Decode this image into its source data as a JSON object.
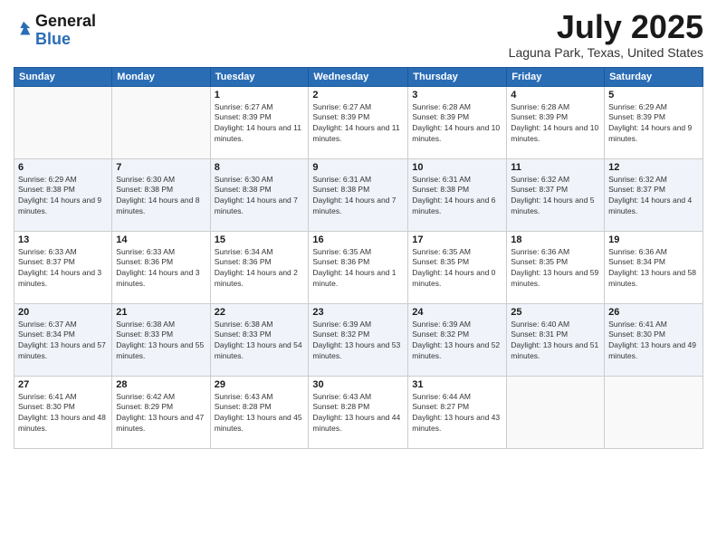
{
  "logo": {
    "general": "General",
    "blue": "Blue"
  },
  "header": {
    "month": "July 2025",
    "location": "Laguna Park, Texas, United States"
  },
  "weekdays": [
    "Sunday",
    "Monday",
    "Tuesday",
    "Wednesday",
    "Thursday",
    "Friday",
    "Saturday"
  ],
  "weeks": [
    [
      {
        "day": "",
        "sunrise": "",
        "sunset": "",
        "daylight": ""
      },
      {
        "day": "",
        "sunrise": "",
        "sunset": "",
        "daylight": ""
      },
      {
        "day": "1",
        "sunrise": "Sunrise: 6:27 AM",
        "sunset": "Sunset: 8:39 PM",
        "daylight": "Daylight: 14 hours and 11 minutes."
      },
      {
        "day": "2",
        "sunrise": "Sunrise: 6:27 AM",
        "sunset": "Sunset: 8:39 PM",
        "daylight": "Daylight: 14 hours and 11 minutes."
      },
      {
        "day": "3",
        "sunrise": "Sunrise: 6:28 AM",
        "sunset": "Sunset: 8:39 PM",
        "daylight": "Daylight: 14 hours and 10 minutes."
      },
      {
        "day": "4",
        "sunrise": "Sunrise: 6:28 AM",
        "sunset": "Sunset: 8:39 PM",
        "daylight": "Daylight: 14 hours and 10 minutes."
      },
      {
        "day": "5",
        "sunrise": "Sunrise: 6:29 AM",
        "sunset": "Sunset: 8:39 PM",
        "daylight": "Daylight: 14 hours and 9 minutes."
      }
    ],
    [
      {
        "day": "6",
        "sunrise": "Sunrise: 6:29 AM",
        "sunset": "Sunset: 8:38 PM",
        "daylight": "Daylight: 14 hours and 9 minutes."
      },
      {
        "day": "7",
        "sunrise": "Sunrise: 6:30 AM",
        "sunset": "Sunset: 8:38 PM",
        "daylight": "Daylight: 14 hours and 8 minutes."
      },
      {
        "day": "8",
        "sunrise": "Sunrise: 6:30 AM",
        "sunset": "Sunset: 8:38 PM",
        "daylight": "Daylight: 14 hours and 7 minutes."
      },
      {
        "day": "9",
        "sunrise": "Sunrise: 6:31 AM",
        "sunset": "Sunset: 8:38 PM",
        "daylight": "Daylight: 14 hours and 7 minutes."
      },
      {
        "day": "10",
        "sunrise": "Sunrise: 6:31 AM",
        "sunset": "Sunset: 8:38 PM",
        "daylight": "Daylight: 14 hours and 6 minutes."
      },
      {
        "day": "11",
        "sunrise": "Sunrise: 6:32 AM",
        "sunset": "Sunset: 8:37 PM",
        "daylight": "Daylight: 14 hours and 5 minutes."
      },
      {
        "day": "12",
        "sunrise": "Sunrise: 6:32 AM",
        "sunset": "Sunset: 8:37 PM",
        "daylight": "Daylight: 14 hours and 4 minutes."
      }
    ],
    [
      {
        "day": "13",
        "sunrise": "Sunrise: 6:33 AM",
        "sunset": "Sunset: 8:37 PM",
        "daylight": "Daylight: 14 hours and 3 minutes."
      },
      {
        "day": "14",
        "sunrise": "Sunrise: 6:33 AM",
        "sunset": "Sunset: 8:36 PM",
        "daylight": "Daylight: 14 hours and 3 minutes."
      },
      {
        "day": "15",
        "sunrise": "Sunrise: 6:34 AM",
        "sunset": "Sunset: 8:36 PM",
        "daylight": "Daylight: 14 hours and 2 minutes."
      },
      {
        "day": "16",
        "sunrise": "Sunrise: 6:35 AM",
        "sunset": "Sunset: 8:36 PM",
        "daylight": "Daylight: 14 hours and 1 minute."
      },
      {
        "day": "17",
        "sunrise": "Sunrise: 6:35 AM",
        "sunset": "Sunset: 8:35 PM",
        "daylight": "Daylight: 14 hours and 0 minutes."
      },
      {
        "day": "18",
        "sunrise": "Sunrise: 6:36 AM",
        "sunset": "Sunset: 8:35 PM",
        "daylight": "Daylight: 13 hours and 59 minutes."
      },
      {
        "day": "19",
        "sunrise": "Sunrise: 6:36 AM",
        "sunset": "Sunset: 8:34 PM",
        "daylight": "Daylight: 13 hours and 58 minutes."
      }
    ],
    [
      {
        "day": "20",
        "sunrise": "Sunrise: 6:37 AM",
        "sunset": "Sunset: 8:34 PM",
        "daylight": "Daylight: 13 hours and 57 minutes."
      },
      {
        "day": "21",
        "sunrise": "Sunrise: 6:38 AM",
        "sunset": "Sunset: 8:33 PM",
        "daylight": "Daylight: 13 hours and 55 minutes."
      },
      {
        "day": "22",
        "sunrise": "Sunrise: 6:38 AM",
        "sunset": "Sunset: 8:33 PM",
        "daylight": "Daylight: 13 hours and 54 minutes."
      },
      {
        "day": "23",
        "sunrise": "Sunrise: 6:39 AM",
        "sunset": "Sunset: 8:32 PM",
        "daylight": "Daylight: 13 hours and 53 minutes."
      },
      {
        "day": "24",
        "sunrise": "Sunrise: 6:39 AM",
        "sunset": "Sunset: 8:32 PM",
        "daylight": "Daylight: 13 hours and 52 minutes."
      },
      {
        "day": "25",
        "sunrise": "Sunrise: 6:40 AM",
        "sunset": "Sunset: 8:31 PM",
        "daylight": "Daylight: 13 hours and 51 minutes."
      },
      {
        "day": "26",
        "sunrise": "Sunrise: 6:41 AM",
        "sunset": "Sunset: 8:30 PM",
        "daylight": "Daylight: 13 hours and 49 minutes."
      }
    ],
    [
      {
        "day": "27",
        "sunrise": "Sunrise: 6:41 AM",
        "sunset": "Sunset: 8:30 PM",
        "daylight": "Daylight: 13 hours and 48 minutes."
      },
      {
        "day": "28",
        "sunrise": "Sunrise: 6:42 AM",
        "sunset": "Sunset: 8:29 PM",
        "daylight": "Daylight: 13 hours and 47 minutes."
      },
      {
        "day": "29",
        "sunrise": "Sunrise: 6:43 AM",
        "sunset": "Sunset: 8:28 PM",
        "daylight": "Daylight: 13 hours and 45 minutes."
      },
      {
        "day": "30",
        "sunrise": "Sunrise: 6:43 AM",
        "sunset": "Sunset: 8:28 PM",
        "daylight": "Daylight: 13 hours and 44 minutes."
      },
      {
        "day": "31",
        "sunrise": "Sunrise: 6:44 AM",
        "sunset": "Sunset: 8:27 PM",
        "daylight": "Daylight: 13 hours and 43 minutes."
      },
      {
        "day": "",
        "sunrise": "",
        "sunset": "",
        "daylight": ""
      },
      {
        "day": "",
        "sunrise": "",
        "sunset": "",
        "daylight": ""
      }
    ]
  ]
}
